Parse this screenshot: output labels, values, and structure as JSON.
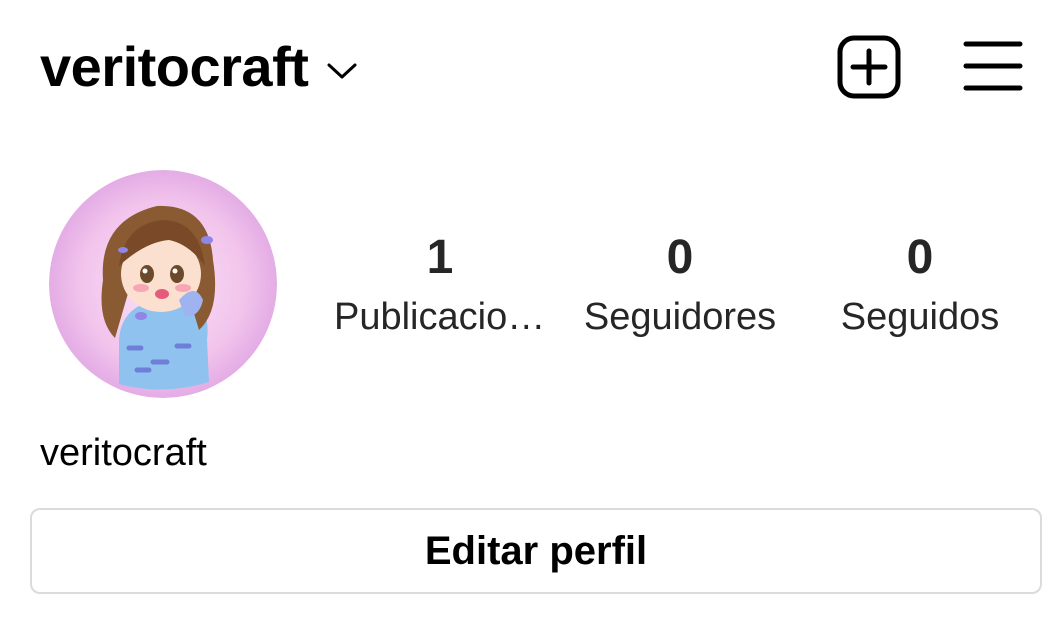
{
  "header": {
    "username": "veritocraft",
    "username_dropdown_icon": "chevron-down-icon",
    "new_post_icon": "plus-square-icon",
    "menu_icon": "hamburger-menu-icon"
  },
  "profile": {
    "avatar_icon": "profile-avatar-illustration",
    "display_name": "veritocraft",
    "stats": {
      "posts": {
        "value": "1",
        "label": "Publicacio…"
      },
      "followers": {
        "value": "0",
        "label": "Seguidores"
      },
      "following": {
        "value": "0",
        "label": "Seguidos"
      }
    },
    "edit_button_label": "Editar perfil"
  },
  "colors": {
    "text": "#000000",
    "stat_text": "#262626",
    "button_border": "#dbdbdb",
    "background": "#ffffff",
    "avatar_background": "#f2c4ec"
  }
}
